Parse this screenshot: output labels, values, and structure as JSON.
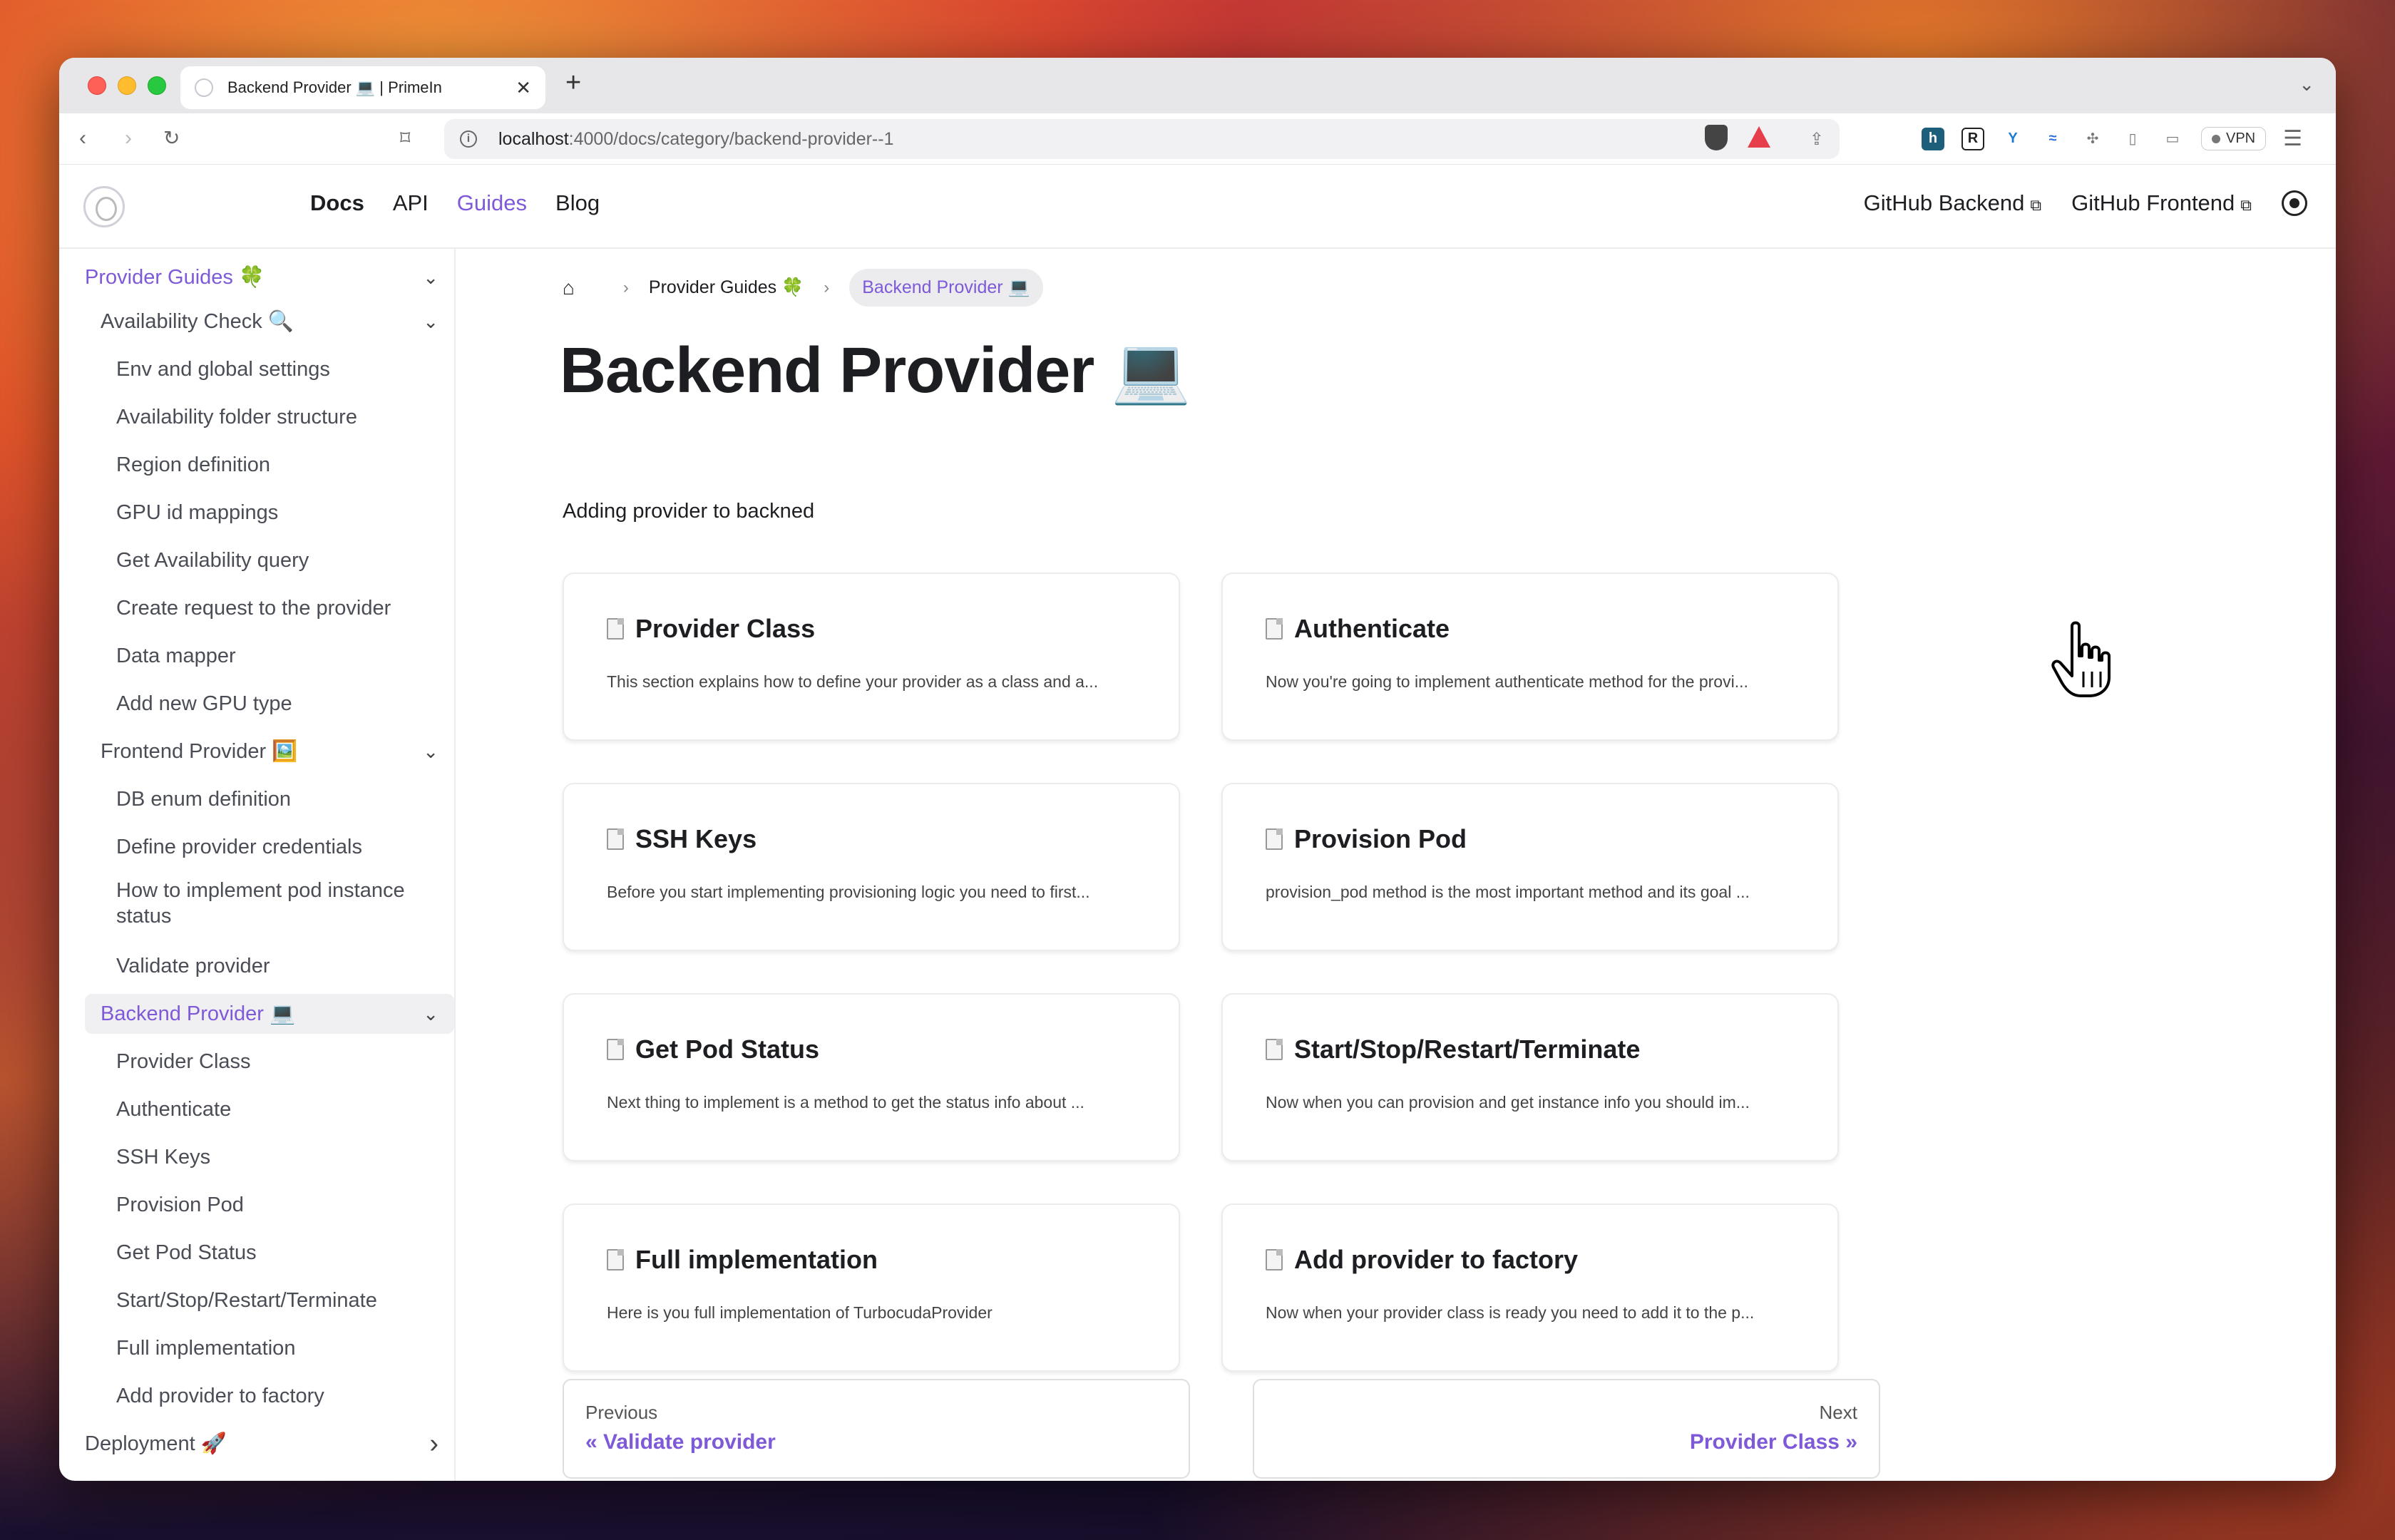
{
  "browser": {
    "tab_title": "Backend Provider 💻 | PrimeIn",
    "tab_close": "✕",
    "new_tab": "+",
    "url_host": "localhost",
    "url_path": ":4000/docs/category/backend-provider--1",
    "vpn_label": "VPN"
  },
  "site_nav": {
    "links": [
      "Docs",
      "API",
      "Guides",
      "Blog"
    ],
    "right_links": [
      "GitHub Backend",
      "GitHub Frontend"
    ]
  },
  "sidebar": {
    "items": [
      {
        "label": "Provider Guides 🍀",
        "level": 0,
        "chevron": "down",
        "active": true
      },
      {
        "label": "Availability Check 🔍",
        "level": 1,
        "chevron": "down"
      },
      {
        "label": "Env and global settings",
        "level": 2
      },
      {
        "label": "Availability folder structure",
        "level": 2
      },
      {
        "label": "Region definition",
        "level": 2
      },
      {
        "label": "GPU id mappings",
        "level": 2
      },
      {
        "label": "Get Availability query",
        "level": 2
      },
      {
        "label": "Create request to the provider",
        "level": 2
      },
      {
        "label": "Data mapper",
        "level": 2
      },
      {
        "label": "Add new GPU type",
        "level": 2
      },
      {
        "label": "Frontend Provider 🖼️",
        "level": 1,
        "chevron": "down"
      },
      {
        "label": "DB enum definition",
        "level": 2
      },
      {
        "label": "Define provider credentials",
        "level": 2
      },
      {
        "label": "How to implement pod instance status",
        "level": 2
      },
      {
        "label": "Validate provider",
        "level": 2
      },
      {
        "label": "Backend Provider 💻",
        "level": 1,
        "chevron": "down",
        "active": true,
        "highlight": true
      },
      {
        "label": "Provider Class",
        "level": 2
      },
      {
        "label": "Authenticate",
        "level": 2
      },
      {
        "label": "SSH Keys",
        "level": 2
      },
      {
        "label": "Provision Pod",
        "level": 2
      },
      {
        "label": "Get Pod Status",
        "level": 2
      },
      {
        "label": "Start/Stop/Restart/Terminate",
        "level": 2
      },
      {
        "label": "Full implementation",
        "level": 2
      },
      {
        "label": "Add provider to factory",
        "level": 2
      },
      {
        "label": "Deployment 🚀",
        "level": 0,
        "chevron": "right"
      }
    ]
  },
  "breadcrumb": {
    "items": [
      "Provider Guides 🍀",
      "Backend Provider 💻"
    ]
  },
  "page": {
    "title": "Backend Provider 💻",
    "description": "Adding provider to backned"
  },
  "cards": [
    {
      "title": "Provider Class",
      "desc": "This section explains how to define your provider as a class and a..."
    },
    {
      "title": "Authenticate",
      "desc": "Now you're going to implement authenticate method for the provi..."
    },
    {
      "title": "SSH Keys",
      "desc": "Before you start implementing provisioning logic you need to first..."
    },
    {
      "title": "Provision Pod",
      "desc": "provision_pod method is the most important method and its goal ..."
    },
    {
      "title": "Get Pod Status",
      "desc": "Next thing to implement is a method to get the status info about ..."
    },
    {
      "title": "Start/Stop/Restart/Terminate",
      "desc": "Now when you can provision and get instance info you should im..."
    },
    {
      "title": "Full implementation",
      "desc": "Here is you full implementation of TurbocudaProvider"
    },
    {
      "title": "Add provider to factory",
      "desc": "Now when your provider class is ready you need to add it to the p..."
    }
  ],
  "pagination": {
    "prev_sub": "Previous",
    "prev_label": "« Validate provider",
    "next_sub": "Next",
    "next_label": "Provider Class »"
  },
  "colors": {
    "accent": "#7e59d8",
    "text": "#1c1e21"
  }
}
